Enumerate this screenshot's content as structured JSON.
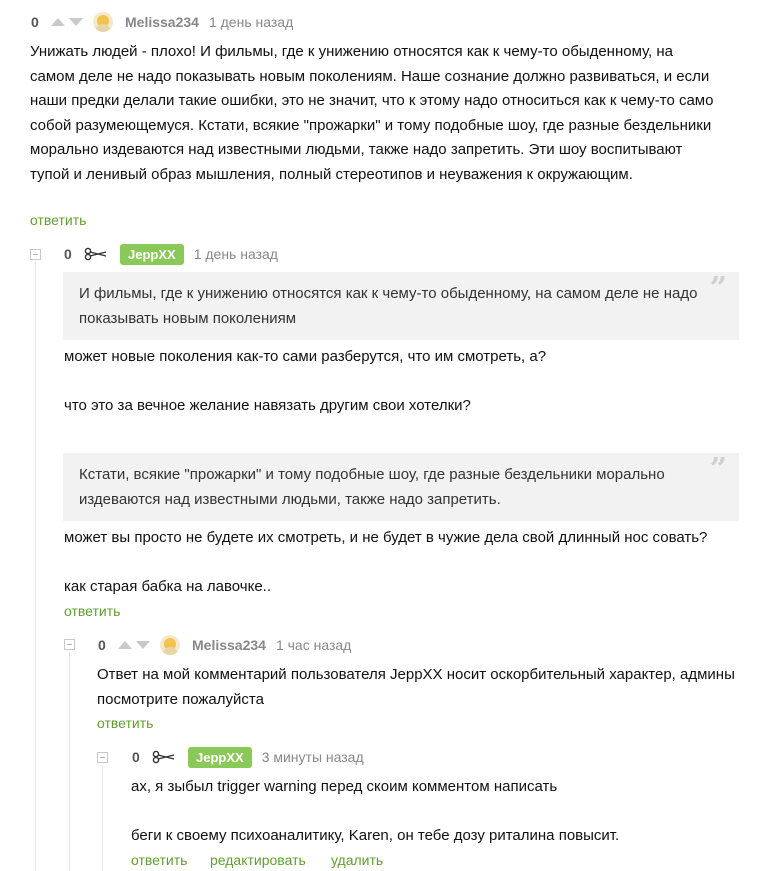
{
  "comments": [
    {
      "rating": "0",
      "user": "Melissa234",
      "time": "1 день назад",
      "text": "Унижать людей - плохо! И фильмы, где к унижению относятся как к чему-то обыденному, на самом деле не надо показывать новым поколениям. Наше сознание должно развиваться, и если наши предки делали такие ошибки, это не значит, что к этому надо относиться как к чему-то само собой разумеющемуся. Кстати, всякие \"прожарки\" и тому подобные шоу, где разные бездельники морально издеваются над известными людьми, также надо запретить. Эти шоу воспитывают тупой и ленивый образ мышления, полный стереотипов и неуважения к окружающим.",
      "reply": "ответить"
    },
    {
      "rating": "0",
      "user": "JeppXX",
      "time": "1 день назад",
      "quote1": "И фильмы, где к унижению относятся как к чему-то обыденному, на самом деле не надо показывать новым поколениям",
      "p1": "может новые поколения как-то сами разберутся, что им смотреть, а?",
      "p2": "что это за вечное желание навязать другим свои хотелки?",
      "quote2": "Кстати, всякие \"прожарки\" и тому подобные шоу, где разные бездельники морально издеваются над известными людьми, также надо запретить.",
      "p3": "может вы просто не будете их смотреть, и не будет в чужие дела свой длинный нос совать?",
      "p4": "как старая бабка на лавочке..",
      "reply": "ответить"
    },
    {
      "rating": "0",
      "user": "Melissa234",
      "time": "1 час назад",
      "text": "Ответ на мой комментарий пользователя JeppXX носит оскорбительный характер, админы посмотрите пожалуйста",
      "reply": "ответить"
    },
    {
      "rating": "0",
      "user": "JeppXX",
      "time": "3 минуты назад",
      "p1": "ах, я зыбыл trigger warning перед скоим комментом написать",
      "p2": "беги к своему психоаналитику, Karen, он тебе дозу риталина повысит.",
      "reply": "ответить",
      "edit": "редактировать",
      "delete": "удалить"
    }
  ],
  "colors": {
    "accent_green": "#8ac858",
    "link_green": "#5f9f2f",
    "quote_bg": "#f2f2f2"
  },
  "icons": {
    "vote_up": "arrow-up-icon",
    "vote_down": "arrow-down-icon",
    "avatar": "avatar-icon",
    "scissors": "scissors-icon",
    "collapse": "collapse-icon",
    "quote": "quote-icon"
  }
}
